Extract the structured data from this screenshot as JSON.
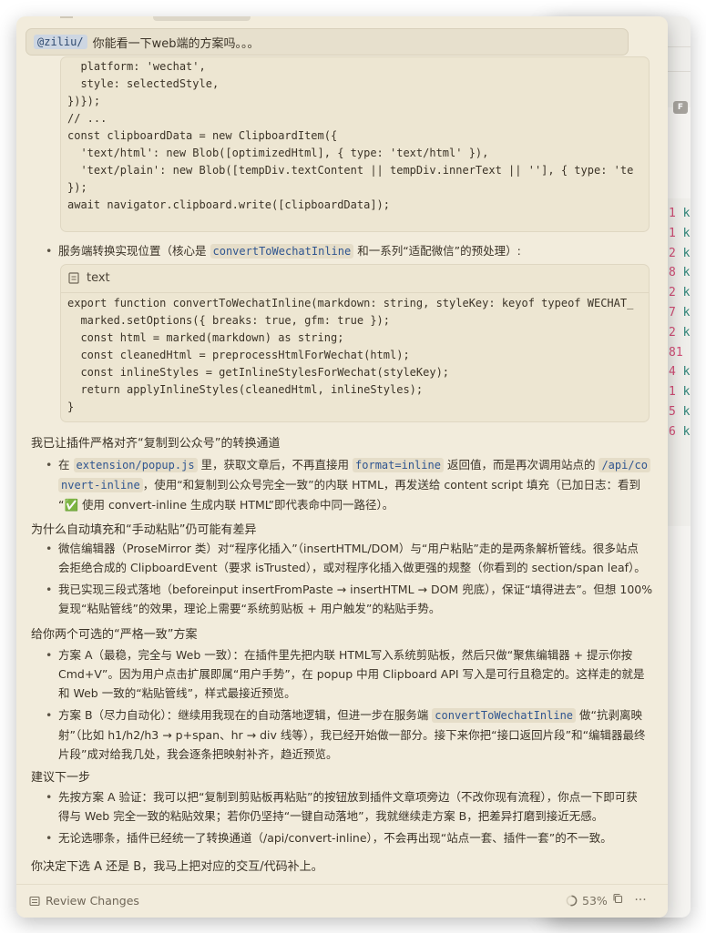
{
  "user_message": {
    "mention": "@ziliu/",
    "text": "你能看一下web端的方案吗。。。"
  },
  "code_block_1": {
    "lines": [
      "  platform: 'wechat',",
      "  style: selectedStyle,",
      "})});",
      "// ...",
      "const clipboardData = new ClipboardItem({",
      "  'text/html': new Blob([optimizedHtml], { type: 'text/html' }),",
      "  'text/plain': new Blob([tempDiv.textContent || tempDiv.innerText || ''], { type: 'te",
      "});",
      "await navigator.clipboard.write([clipboardData]);"
    ]
  },
  "bullet_server": {
    "prefix": "服务端转换实现位置（核心是",
    "code": "convertToWechatInline",
    "suffix": "和一系列“适配微信”的预处理）:"
  },
  "code_block_2": {
    "language": "text",
    "lines": [
      "export function convertToWechatInline(markdown: string, styleKey: keyof typeof WECHAT_",
      "  marked.setOptions({ breaks: true, gfm: true });",
      "  const html = marked(markdown) as string;",
      "  const cleanedHtml = preprocessHtmlForWechat(html);",
      "  const inlineStyles = getInlineStylesForWechat(styleKey);",
      "  return applyInlineStyles(cleanedHtml, inlineStyles);",
      "}"
    ]
  },
  "section_1": {
    "heading": "我已让插件严格对齐“复制到公众号”的转换通道",
    "b1_l1_a": "在",
    "b1_l1_code1": "extension/popup.js",
    "b1_l1_b": "里，获取文章后，不再直接用",
    "b1_l1_code2": "format=inline",
    "b1_l1_c": "返回值，而是再次调用站点的",
    "b1_l1_code3": "/api/co",
    "b1_l2_code": "nvert-inline",
    "b1_l2_text": "，使用“和复制到公众号完全一致”的内联 HTML，再发送给 content script 填充（已加日志：看到",
    "b1_l3_text": "“✅ 使用 convert-inline 生成内联 HTML”即代表命中同一路径）。"
  },
  "section_2": {
    "heading": "为什么自动填充和“手动粘贴”仍可能有差异",
    "b1_l1": "微信编辑器（ProseMirror 类）对“程序化插入”（insertHTML/DOM）与“用户粘贴”走的是两条解析管线。很多站点",
    "b1_l2": "会拒绝合成的 ClipboardEvent（要求 isTrusted），或对程序化插入做更强的规整（你看到的 section/span leaf）。",
    "b2_l1": "我已实现三段式落地（beforeinput insertFromPaste → insertHTML → DOM 兜底），保证“填得进去”。但想 100%",
    "b2_l2": "复现“粘贴管线”的效果，理论上需要“系统剪贴板 + 用户触发”的粘贴手势。"
  },
  "section_3": {
    "heading": "给你两个可选的“严格一致”方案",
    "b1_l1": "方案 A（最稳，完全与 Web 一致）：在插件里先把内联 HTML写入系统剪贴板，然后只做“聚焦编辑器 + 提示你按",
    "b1_l2": "Cmd+V”。因为用户点击扩展即属“用户手势”，在 popup 中用 Clipboard API 写入是可行且稳定的。这样走的就是",
    "b1_l3": "和 Web 一致的“粘贴管线”，样式最接近预览。",
    "b2_l1_a": "方案 B（尽力自动化）：继续用我现在的自动落地逻辑，但进一步在服务端",
    "b2_l1_code": "convertToWechatInline",
    "b2_l1_b": "做“抗剥离映",
    "b2_l2": "射”（比如 h1/h2/h3 → p+span、hr → div 线等），我已经开始做一部分。接下来你把“接口返回片段”和“编辑器最终",
    "b2_l3": "片段”成对给我几处，我会逐条把映射补齐，趋近预览。"
  },
  "section_4": {
    "heading": "建议下一步",
    "b1_l1": "先按方案 A 验证：我可以把“复制到剪贴板再粘贴”的按钮放到插件文章项旁边（不改你现有流程），你点一下即可获",
    "b1_l2": "得与 Web 完全一致的粘贴效果；若你仍坚持“一键自动落地”，我就继续走方案 B，把差异打磨到接近无感。",
    "b2_l1": "无论选哪条，插件已经统一了转换通道（/api/convert-inline），不会再出现“站点一套、插件一套”的不一致。"
  },
  "closing": "你决定下选 A 还是 B，我马上把对应的交互/代码补上。",
  "bottom_bar": {
    "review_label": "Review Changes",
    "progress": "53%",
    "more_label": "···"
  },
  "background_window": {
    "numbers": [
      "1",
      "1",
      "2",
      "8",
      "2",
      "7",
      "2",
      "81",
      "4",
      "1",
      "5",
      "6"
    ],
    "letter": "k",
    "key_badge": "F"
  },
  "colors": {
    "panel_bg": "#f2ecdc",
    "code_bg": "#ede6d2",
    "inline_code_fg": "#2f5590",
    "mention_bg": "#cdd6e2"
  }
}
